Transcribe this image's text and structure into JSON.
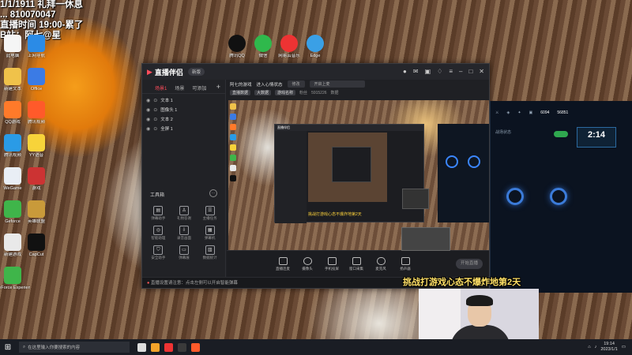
{
  "overlay_text": [
    "1/1/1911 礼拜一休息",
    "... 810070047",
    "直播时间 19:00-累了",
    "B站：阿七@星"
  ],
  "desktop_icons": [
    {
      "label": "此电脑",
      "color": "#f5f5f5"
    },
    {
      "label": "上网导航",
      "color": "#2b8be6"
    },
    {
      "label": "新建文本",
      "color": "#f0c24a"
    },
    {
      "label": "Office",
      "color": "#3b7be5"
    },
    {
      "label": "QQ游戏",
      "color": "#ff7a2a"
    },
    {
      "label": "腾讯视频",
      "color": "#ff5a2a"
    },
    {
      "label": "腾讯视频",
      "color": "#2a9be6"
    },
    {
      "label": "YY语音",
      "color": "#f7d33a"
    },
    {
      "label": "WeGame",
      "color": "#e9eef5"
    },
    {
      "label": "游戏",
      "color": "#c33"
    },
    {
      "label": "Geforce",
      "color": "#3fb54a"
    },
    {
      "label": "英雄联盟",
      "color": "#c99a3a"
    },
    {
      "label": "新建游戏",
      "color": "#e9e9e9"
    },
    {
      "label": "CapCut",
      "color": "#111"
    },
    {
      "label": "GeForce Experience",
      "color": "#3fb54a"
    }
  ],
  "top_icons": [
    {
      "label": "腾讯QQ",
      "color": "#111"
    },
    {
      "label": "微信",
      "color": "#2fb94c"
    },
    {
      "label": "网易云音乐",
      "color": "#e33"
    },
    {
      "label": "Edge",
      "color": "#3aa0e6"
    }
  ],
  "window": {
    "app_name": "直播伴侣",
    "version": "新版",
    "tabs": [
      "场景1",
      "场景",
      "可添加"
    ],
    "sources": [
      "文本 1",
      "图像头 1",
      "文本 2",
      "全屏 1"
    ],
    "tools_title": "工具箱",
    "tools": [
      "弹幕助手",
      "礼物答谢",
      "主播任务",
      "智能助理",
      "录音画面",
      "弹幕机",
      "安全助手",
      "弹幕展",
      "数据统计"
    ],
    "room_title": "阿七的游戏",
    "room_prompt": "进入心情状态",
    "room_btn": "修改",
    "room_input": "开启上麦",
    "meta": [
      "直播数据",
      "大数据",
      "游戏名称",
      "粉丝",
      "5915226",
      "数据"
    ],
    "controls": [
      "直播连麦",
      "摄像头",
      "手机投屏",
      "窗口采集",
      "麦克风",
      "扬声器"
    ],
    "start": "开始直播",
    "status": "直播设置请注意：点击左侧可以开启智能弹幕",
    "nested_caption": "挑战打游戏心态不爆炸地第2天"
  },
  "game": {
    "counter": "2:14",
    "top_stats": [
      "6094",
      "56851"
    ],
    "header": "战场状态"
  },
  "caption": "挑战打游戏心态不爆炸地第2天",
  "taskbar": {
    "search_placeholder": "在这里输入你要搜索的内容",
    "time": "19:14",
    "date": "2023/1/1"
  }
}
